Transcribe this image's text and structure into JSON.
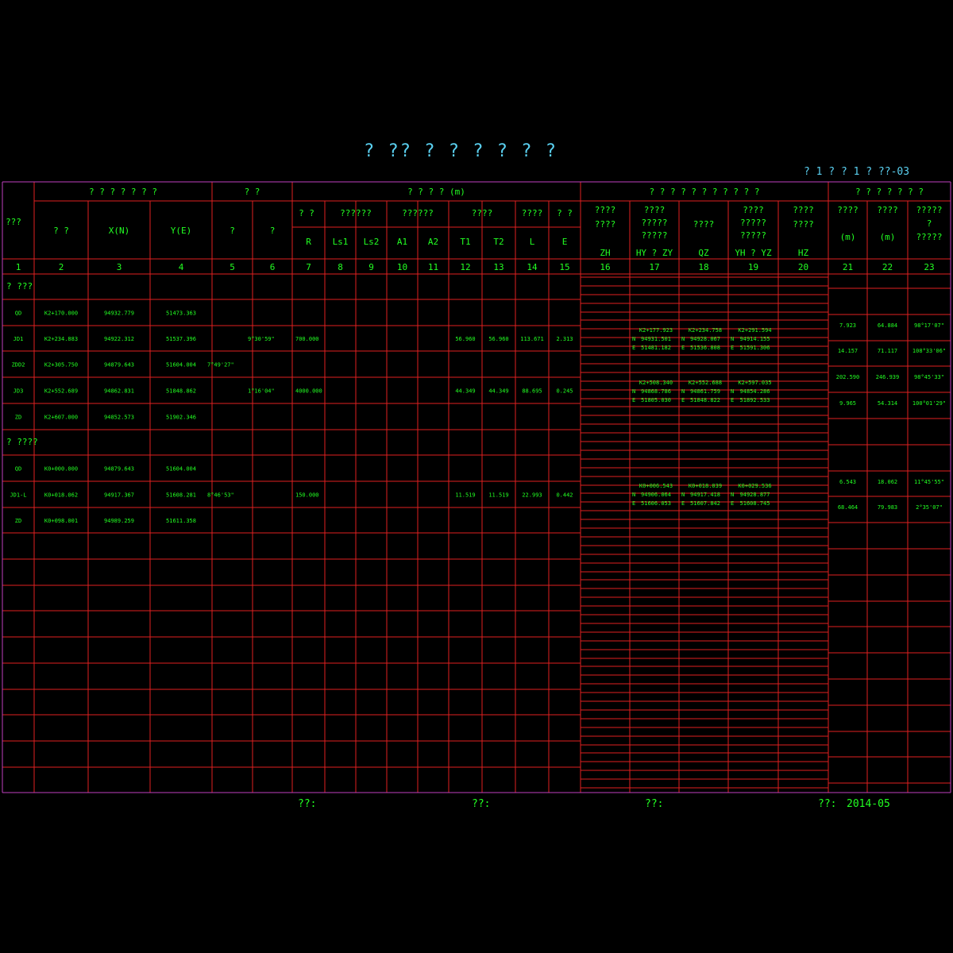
{
  "title": "?   ??   ?   ?   ?   ?   ?   ?",
  "sheet_no": "?  1   ? ?  1   ?  ??-03",
  "group_headers": {
    "g1": "? ? ? ? ? ? ?",
    "g2": "?     ?",
    "g3": "? ? ? ?     (m)",
    "g4": "? ? ? ? ? ? ? ? ? ? ?",
    "g5": "? ? ? ? ? ? ?"
  },
  "col_headers": {
    "c1": "???",
    "c2": "?   ?",
    "c3": "X(N)",
    "c4": "Y(E)",
    "c5": "?",
    "c6": "?",
    "sub7": "? ?",
    "sub89": "??????",
    "sub1011": "??????",
    "sub1213": "????",
    "sub14": "????",
    "sub15": "? ?",
    "R": "R",
    "Ls1": "Ls1",
    "Ls2": "Ls2",
    "A1": "A1",
    "A2": "A2",
    "T1": "T1",
    "T2": "T2",
    "L": "L",
    "E": "E",
    "h16a": "????",
    "h16b": "????",
    "h16c": "ZH",
    "h17a": "????",
    "h17b": "?????",
    "h17c": "?????",
    "h17d": "HY ? ZY",
    "h18a": "????",
    "h18b": "QZ",
    "h19a": "????",
    "h19b": "?????",
    "h19c": "?????",
    "h19d": "YH ? YZ",
    "h20a": "????",
    "h20b": "????",
    "h20c": "HZ",
    "h21a": "????",
    "h21b": "(m)",
    "h22a": "????",
    "h22b": "(m)",
    "h23a": "?????",
    "h23b": "?",
    "h23c": "?????"
  },
  "col_numbers": [
    "1",
    "2",
    "3",
    "4",
    "5",
    "6",
    "7",
    "8",
    "9",
    "10",
    "11",
    "12",
    "13",
    "14",
    "15",
    "16",
    "17",
    "18",
    "19",
    "20",
    "21",
    "22",
    "23"
  ],
  "sections": {
    "s1": "?   ???",
    "s2": "?   ????"
  },
  "rows": [
    {
      "c1": "QD",
      "c2": "K2+170.000",
      "c3": "94932.779",
      "c4": "51473.363",
      "c5": "",
      "c6": "",
      "c7": "",
      "c12": "",
      "c13": "",
      "c14": "",
      "c15": ""
    },
    {
      "c1": "JD1",
      "c2": "K2+234.883",
      "c3": "94922.312",
      "c4": "51537.396",
      "c5": "",
      "c6": "9°30'59\"",
      "c7": "700.000",
      "c12": "56.960",
      "c13": "56.960",
      "c14": "113.671",
      "c15": "2.313"
    },
    {
      "c1": "ZDD2",
      "c2": "K2+305.750",
      "c3": "94879.643",
      "c4": "51604.004",
      "c5": "7°49'27\"",
      "c6": "",
      "c7": "",
      "c12": "",
      "c13": "",
      "c14": "",
      "c15": ""
    },
    {
      "c1": "JD3",
      "c2": "K2+552.689",
      "c3": "94862.831",
      "c4": "51848.862",
      "c5": "",
      "c6": "1°16'04\"",
      "c7": "4000.000",
      "c12": "44.349",
      "c13": "44.349",
      "c14": "88.695",
      "c15": "0.245"
    },
    {
      "c1": "ZD",
      "c2": "K2+607.000",
      "c3": "94852.573",
      "c4": "51902.346",
      "c5": "",
      "c6": "",
      "c7": "",
      "c12": "",
      "c13": "",
      "c14": "",
      "c15": ""
    },
    {
      "c1": "QD",
      "c2": "K0+000.000",
      "c3": "94879.643",
      "c4": "51604.004",
      "c5": "",
      "c6": "",
      "c7": "",
      "c12": "",
      "c13": "",
      "c14": "",
      "c15": ""
    },
    {
      "c1": "JD1-L",
      "c2": "K0+018.062",
      "c3": "94917.367",
      "c4": "51608.281",
      "c5": "8°46'53\"",
      "c6": "",
      "c7": "150.000",
      "c12": "11.519",
      "c13": "11.519",
      "c14": "22.993",
      "c15": "0.442"
    },
    {
      "c1": "ZD",
      "c2": "K0+098.001",
      "c3": "94989.259",
      "c4": "51611.358",
      "c5": "",
      "c6": "",
      "c7": "",
      "c12": "",
      "c13": "",
      "c14": "",
      "c15": ""
    }
  ],
  "curve_blocks": [
    {
      "k17": "K2+177.923",
      "k18": "K2+234.758",
      "k19": "K2+291.594",
      "n17": "94931.501",
      "n18": "94928.067",
      "n19": "94914.155",
      "e17": "51481.182",
      "e18": "51536.808",
      "e19": "51591.306"
    },
    {
      "k17": "K2+508.340",
      "k18": "K2+552.688",
      "k19": "K2+597.035",
      "n17": "94868.786",
      "n18": "94861.759",
      "n19": "94854.286",
      "e17": "51805.030",
      "e18": "51848.822",
      "e19": "51892.533"
    },
    {
      "k17": "K0+006.543",
      "k18": "K0+018.039",
      "k19": "K0+029.536",
      "n17": "94906.064",
      "n18": "94917.418",
      "n19": "94928.877",
      "e17": "51606.053",
      "e18": "51607.842",
      "e19": "51608.745"
    }
  ],
  "curve_labels": {
    "n": "N",
    "e": "E"
  },
  "distances": [
    {
      "c21": "7.923",
      "c22": "64.884",
      "c23": "98°17'07\""
    },
    {
      "c21": "14.157",
      "c22": "71.117",
      "c23": "108°33'06\""
    },
    {
      "c21": "202.590",
      "c22": "246.939",
      "c23": "98°45'33\""
    },
    {
      "c21": "9.965",
      "c22": "54.314",
      "c23": "100°01'29\""
    },
    {
      "c21": "6.543",
      "c22": "18.062",
      "c23": "11°45'55\""
    },
    {
      "c21": "68.464",
      "c22": "79.983",
      "c23": "2°35'07\""
    }
  ],
  "footer": {
    "f1": "??:",
    "f2": "??:",
    "f3": "??:",
    "f4": "??:",
    "date": "2014-05"
  },
  "colors": {
    "border": "#c040c0",
    "grid": "#e02020",
    "text": "#22ff22",
    "title": "#5ad0f0"
  }
}
